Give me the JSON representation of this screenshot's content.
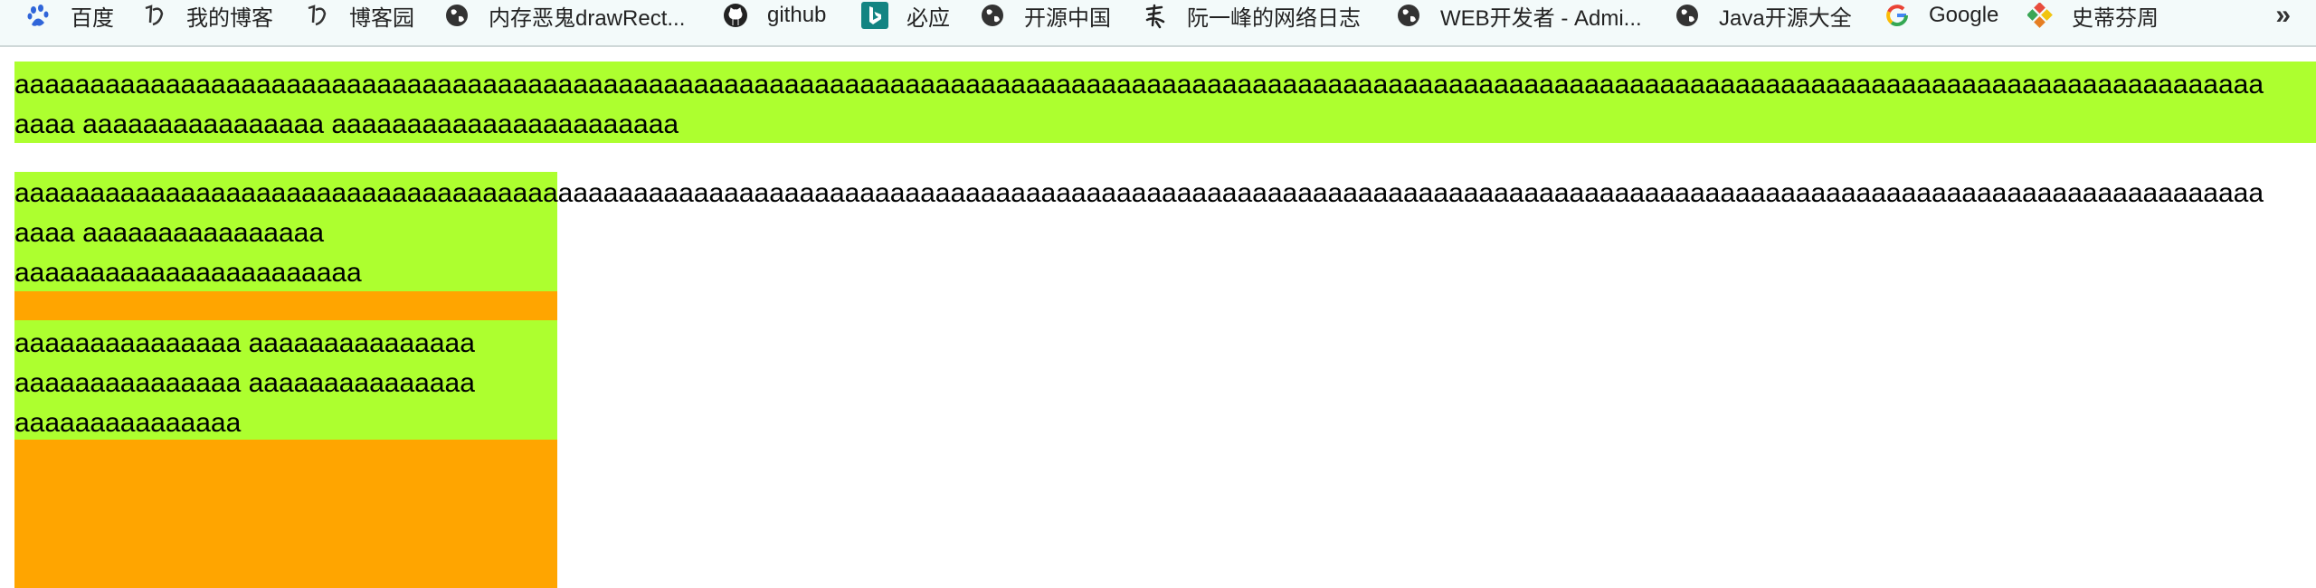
{
  "bookmarks": [
    {
      "label": "百度",
      "icon": "baidu-paw-icon"
    },
    {
      "label": "我的博客",
      "icon": "cnblogs-icon"
    },
    {
      "label": "博客园",
      "icon": "cnblogs-icon"
    },
    {
      "label": "内存恶鬼drawRect...",
      "icon": "globe-icon"
    },
    {
      "label": "github",
      "icon": "github-icon"
    },
    {
      "label": "必应",
      "icon": "bing-icon"
    },
    {
      "label": "开源中国",
      "icon": "globe-icon"
    },
    {
      "label": "阮一峰的网络日志",
      "icon": "ruanyifeng-icon"
    },
    {
      "label": "WEB开发者 - Admi...",
      "icon": "globe-icon"
    },
    {
      "label": "Java开源大全",
      "icon": "globe-icon"
    },
    {
      "label": "Google",
      "icon": "google-icon"
    },
    {
      "label": "史蒂芬周",
      "icon": "colorful-diamond-icon"
    }
  ],
  "more_label": "»",
  "content": {
    "block1_line1": "aaaaaaaaaaaaaaaaaaaaaaaaaaaaaaaaaaaaaaaaaaaaaaaaaaaaaaaaaaaaaaaaaaaaaaaaaaaaaaaaaaaaaaaaaaaaaaaaaaaaaaaaaaaaaaaaaaaaaaaaaaaaaaaaaaaaaaaaaaaaaaaaaaaaa",
    "block1_line2": "aaaa aaaaaaaaaaaaaaaa aaaaaaaaaaaaaaaaaaaaaaa",
    "block2_line1": "aaaaaaaaaaaaaaaaaaaaaaaaaaaaaaaaaaaaaaaaaaaaaaaaaaaaaaaaaaaaaaaaaaaaaaaaaaaaaaaaaaaaaaaaaaaaaaaaaaaaaaaaaaaaaaaaaaaaaaaaaaaaaaaaaaaaaaaaaaaaaaaaaaaaa",
    "block2_line2": "aaaa aaaaaaaaaaaaaaaa",
    "block2_line3": "aaaaaaaaaaaaaaaaaaaaaaa",
    "block3_line1": "aaaaaaaaaaaaaaa aaaaaaaaaaaaaaa",
    "block3_line2": "aaaaaaaaaaaaaaa aaaaaaaaaaaaaaa",
    "block3_line3": "aaaaaaaaaaaaaaa"
  },
  "colors": {
    "green": "#adff2f",
    "orange": "#ffa500",
    "bookmark_bar": "#f3fafa"
  }
}
